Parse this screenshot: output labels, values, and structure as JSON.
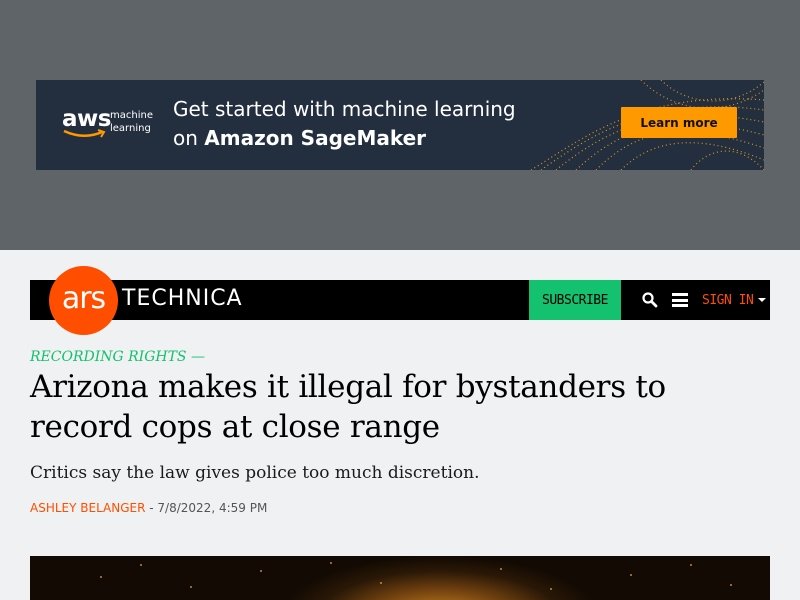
{
  "ad": {
    "brand_word": "aws",
    "brand_sub_line1": "machine",
    "brand_sub_line2": "learning",
    "headline_line1": "Get started with machine learning",
    "headline_prefix": "on ",
    "headline_bold": "Amazon SageMaker",
    "cta_label": "Learn more",
    "colors": {
      "background": "#232f3e",
      "cta": "#ff9900",
      "swirl": "#e8a21e"
    }
  },
  "nav": {
    "logo_ars": "ars",
    "logo_technica": "TECHNICA",
    "subscribe_label": "SUBSCRIBE",
    "search_icon": "search-icon",
    "menu_icon": "hamburger-menu-icon",
    "signin_label": "SIGN IN",
    "colors": {
      "brand": "#ff4e00",
      "subscribe": "#13c16e",
      "bar": "#000000"
    }
  },
  "article": {
    "kicker": "RECORDING RIGHTS —",
    "headline": "Arizona makes it illegal for bystanders to record cops at close range",
    "dek": "Critics say the law gives police too much discretion.",
    "author": "Ashley Belanger",
    "byline_separator": " - ",
    "timestamp": "7/8/2022, 4:59 PM"
  }
}
